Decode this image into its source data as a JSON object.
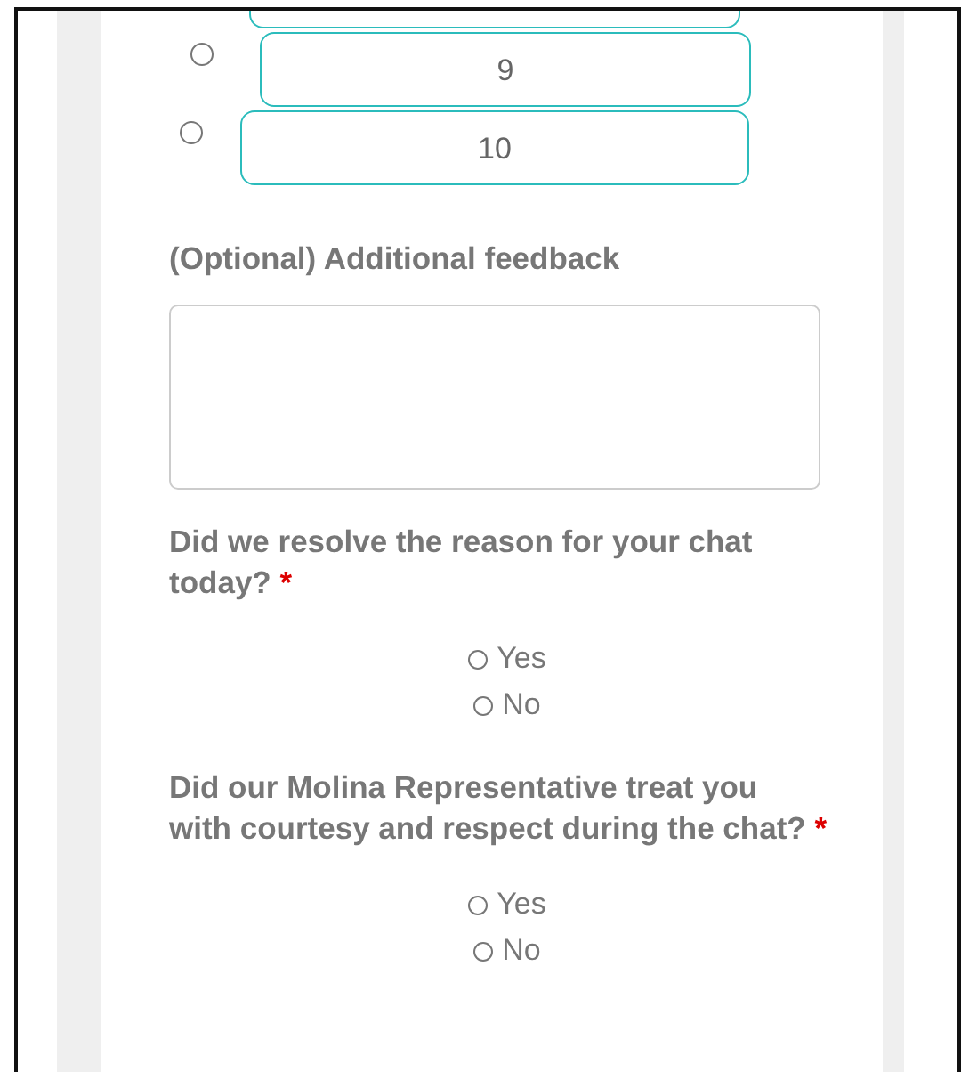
{
  "rating_options": [
    {
      "kind": "partial"
    },
    {
      "kind": "option",
      "label": "9",
      "selected": false
    },
    {
      "kind": "option",
      "label": "10",
      "selected": false
    }
  ],
  "feedback": {
    "label": "(Optional) Additional feedback"
  },
  "questions": [
    {
      "text": "Did we resolve the reason for your chat today?",
      "required_mark": "*",
      "options": [
        {
          "label": "Yes",
          "selected": false
        },
        {
          "label": "No",
          "selected": false
        }
      ]
    },
    {
      "text": "Did our Molina Representative treat you with courtesy and respect during the chat?",
      "required_mark": "*",
      "options": [
        {
          "label": "Yes",
          "selected": false
        },
        {
          "label": "No",
          "selected": false
        }
      ]
    }
  ]
}
